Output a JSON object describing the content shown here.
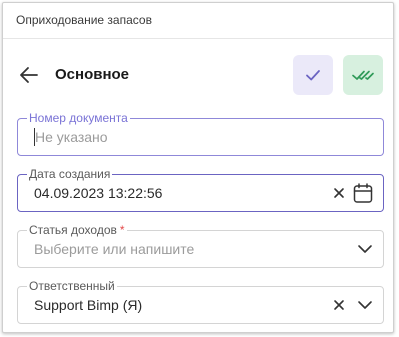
{
  "window": {
    "title": "Оприходование запасов"
  },
  "header": {
    "title": "Основное"
  },
  "fields": {
    "doc_number": {
      "label": "Номер документа",
      "placeholder": "Не указано"
    },
    "created_at": {
      "label": "Дата создания",
      "value": "04.09.2023 13:22:56"
    },
    "income_item": {
      "label": "Статья доходов",
      "required_mark": "*",
      "placeholder": "Выберите или напишите"
    },
    "responsible": {
      "label": "Ответственный",
      "value": "Support Bimp (Я)"
    }
  },
  "colors": {
    "accent": "#6b64c2",
    "check_button_bg": "#ebe9f9",
    "check_all_button_bg": "#d7f0df",
    "required": "#e34848"
  },
  "icons": {
    "back": "arrow-left-icon",
    "check": "check-icon",
    "check_all": "double-check-icon",
    "clear": "close-icon",
    "calendar": "calendar-icon",
    "dropdown": "chevron-down-icon"
  }
}
